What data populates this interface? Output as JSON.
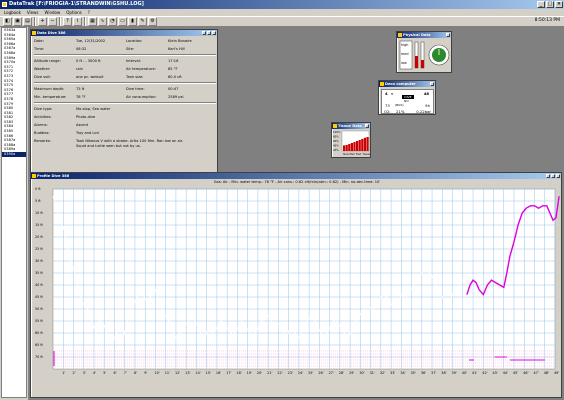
{
  "app": {
    "title": "DataTrak [F:\\FRIOGIA-1\\STRANDWIN\\GSHU.LOG]",
    "clock": "8:50:13 PM"
  },
  "menus": [
    "Logbook",
    "Views",
    "Window",
    "Options",
    "?"
  ],
  "toolbar": [
    "open-icon",
    "save-icon",
    "print-icon",
    "zoom-in-icon",
    "zoom-out-icon",
    "help-icon",
    "info-icon",
    "chart-icon",
    "profile-icon",
    "gauge-icon",
    "deco-icon",
    "tissue-icon",
    "tools-icon",
    "settings-icon"
  ],
  "dive_list": [
    "0363a",
    "0364a",
    "0365a",
    "0366a",
    "0367a",
    "0368a",
    "0369a",
    "0370a",
    "0371",
    "0372",
    "0373",
    "0374",
    "0375",
    "0376",
    "0377",
    "0378",
    "0379",
    "0380",
    "0381",
    "0382",
    "0383",
    "0384",
    "0385",
    "0386",
    "0387a",
    "0388a",
    "0389a",
    "0390a"
  ],
  "selected_dive_index": 27,
  "info": {
    "title": "Data Dive 386",
    "rows": [
      {
        "l1": "Date:",
        "v1": "Tue, 12/31/2002",
        "l2": "Location:",
        "v2": "Klein Bonaire"
      },
      {
        "l1": "Time:",
        "v1": "08:32",
        "l2": "Site:",
        "v2": "Karl's Hill"
      },
      {
        "l1": "Altitude range:",
        "v1": "0 ft ... 3000 ft",
        "l2": "Interval:",
        "v2": "17:16"
      },
      {
        "l1": "Weather:",
        "v1": "rain",
        "l2": "Air temperature:",
        "v2": "85 °F"
      },
      {
        "l1": "Dive suit:",
        "v1": "one pc. wetsuit",
        "l2": "Tank size:",
        "v2": "80.0 cft"
      },
      {
        "l1": "Maximum depth:",
        "v1": "73 ft",
        "l2": "Dive time:",
        "v2": "00:47"
      },
      {
        "l1": "Min. temperature:",
        "v1": "78 °F",
        "l2": "Air consumption:",
        "v2": "2589 psi"
      },
      {
        "l1": "Dive type:",
        "v1": "Mo-slop, Sea water",
        "l2": "",
        "v2": ""
      },
      {
        "l1": "Activities:",
        "v1": "Photo-dive",
        "l2": "",
        "v2": ""
      },
      {
        "l1": "Alarms:",
        "v1": "Ascent",
        "l2": "",
        "v2": ""
      },
      {
        "l1": "Buddies:",
        "v1": "Troy and Lori",
        "l2": "",
        "v2": ""
      },
      {
        "l1": "Remarks:",
        "v1": "Took Nikonos V with a strobe. Artia 100 film. Ran low on air.",
        "l2": "",
        "v2": ""
      }
    ],
    "remarks_line2": "Squid and turtle seen but not by us."
  },
  "physical": {
    "title": "Physical Data",
    "labels": [
      "high",
      "med",
      "low"
    ]
  },
  "deco": {
    "title": "Deco computer",
    "depth": "4",
    "depth_unit": "ft",
    "time": "48",
    "mode_label": "DIVE",
    "mode_value": "NO",
    "pressure": "73",
    "pressure_label": "(BGS)",
    "minutes": "9h",
    "o2_label": "O2:",
    "o2": "21%",
    "ppo2": "0.22bar"
  },
  "tissue": {
    "title": "Tissue Data",
    "y_labels": [
      "100%",
      "80%",
      "60%",
      "40%",
      "20%"
    ],
    "x_labels": [
      "Slow",
      "Med",
      "Fast",
      "Tissue"
    ],
    "values": [
      0.28,
      0.3,
      0.35,
      0.4,
      0.45,
      0.5,
      0.55,
      0.6,
      0.66,
      0.7
    ]
  },
  "profile": {
    "title": "Profile Dive 386",
    "subtitle": "Gas: Air  -  Min. water temp.: 78 °F  -  Air cons.: 0.62 cft/min(atm.: 0.62)  -  Min. no-dec.time: 10'"
  },
  "chart_data": {
    "type": "line",
    "ylabel": "",
    "y_axis_unit": "ft",
    "y_ticks": [
      "0 ft",
      "5 ft",
      "10 ft",
      "15 ft",
      "20 ft",
      "25 ft",
      "30 ft",
      "35 ft",
      "40 ft",
      "45 ft",
      "50 ft",
      "55 ft",
      "60 ft",
      "65 ft",
      "70 ft"
    ],
    "ylim": [
      0,
      75
    ],
    "y_inverted": true,
    "x_ticks": [
      "1'",
      "2'",
      "3'",
      "4'",
      "5'",
      "6'",
      "7'",
      "8'",
      "9'",
      "10'",
      "11'",
      "12'",
      "13'",
      "14'",
      "15'",
      "16'",
      "17'",
      "18'",
      "19'",
      "20'",
      "21'",
      "22'",
      "23'",
      "24'",
      "25'",
      "26'",
      "27'",
      "28'",
      "29'",
      "30'",
      "31'",
      "32'",
      "33'",
      "34'",
      "35'",
      "36'",
      "37'",
      "38'",
      "39'",
      "40'",
      "41'",
      "42'",
      "43'",
      "44'",
      "45'",
      "46'",
      "47'",
      "48'",
      "49'"
    ],
    "xlim": [
      0,
      49
    ],
    "series": [
      {
        "color": "#ffffff",
        "points": [
          [
            0,
            3
          ],
          [
            0.3,
            8
          ],
          [
            0.7,
            13
          ],
          [
            1,
            16
          ],
          [
            1.3,
            22
          ],
          [
            1.6,
            28
          ],
          [
            2,
            33
          ],
          [
            2.3,
            38
          ],
          [
            2.6,
            43
          ],
          [
            3,
            48
          ],
          [
            3.4,
            50
          ],
          [
            3.8,
            55
          ],
          [
            4.2,
            60
          ],
          [
            4.6,
            55
          ],
          [
            5,
            57
          ],
          [
            5.4,
            62
          ],
          [
            5.8,
            64
          ],
          [
            6.2,
            60
          ],
          [
            6.5,
            63
          ],
          [
            6.9,
            62
          ],
          [
            7.3,
            54
          ],
          [
            7.6,
            50
          ],
          [
            8,
            47
          ],
          [
            8.4,
            42
          ],
          [
            8.8,
            44
          ],
          [
            9.2,
            48
          ],
          [
            9.6,
            44
          ],
          [
            10,
            42
          ],
          [
            10.4,
            47
          ],
          [
            10.8,
            52
          ],
          [
            11.2,
            54
          ],
          [
            11.6,
            58
          ],
          [
            12,
            62
          ],
          [
            12.4,
            60
          ],
          [
            12.8,
            57
          ],
          [
            13.2,
            55
          ],
          [
            13.6,
            53
          ],
          [
            14,
            56
          ],
          [
            14.4,
            60
          ],
          [
            14.8,
            57
          ],
          [
            15.2,
            63
          ],
          [
            15.6,
            60
          ],
          [
            16,
            58
          ],
          [
            16.4,
            55
          ],
          [
            16.8,
            57
          ],
          [
            17.2,
            59
          ],
          [
            17.6,
            61
          ],
          [
            18,
            58
          ],
          [
            18.4,
            55
          ],
          [
            18.8,
            57
          ],
          [
            19.2,
            60
          ],
          [
            19.6,
            62
          ],
          [
            20,
            58
          ],
          [
            20.4,
            55
          ],
          [
            20.8,
            52
          ],
          [
            21.2,
            54
          ],
          [
            21.6,
            57
          ],
          [
            22,
            56
          ],
          [
            22.4,
            59
          ],
          [
            22.8,
            62
          ],
          [
            23.2,
            57
          ],
          [
            23.6,
            60
          ],
          [
            24,
            62
          ],
          [
            24.4,
            58
          ],
          [
            24.8,
            55
          ],
          [
            25.2,
            53
          ],
          [
            25.6,
            55
          ],
          [
            26,
            59
          ],
          [
            26.4,
            62
          ],
          [
            26.8,
            60
          ],
          [
            27.2,
            56
          ],
          [
            27.6,
            54
          ],
          [
            28,
            57
          ],
          [
            28.4,
            60
          ],
          [
            28.8,
            62
          ],
          [
            29.2,
            58
          ],
          [
            29.6,
            55
          ],
          [
            30,
            52
          ],
          [
            30.4,
            50
          ],
          [
            30.8,
            48
          ],
          [
            31.2,
            51
          ],
          [
            31.6,
            48
          ],
          [
            32,
            45
          ],
          [
            32.4,
            44
          ],
          [
            32.8,
            47
          ],
          [
            33.2,
            49
          ],
          [
            33.6,
            48
          ],
          [
            34,
            44
          ],
          [
            34.4,
            46
          ],
          [
            34.8,
            43
          ],
          [
            35.2,
            40
          ],
          [
            35.6,
            38
          ],
          [
            36,
            35
          ],
          [
            36.4,
            33
          ],
          [
            36.8,
            35
          ],
          [
            37.2,
            38
          ],
          [
            37.6,
            42
          ],
          [
            38,
            45
          ],
          [
            38.4,
            48
          ],
          [
            38.8,
            46
          ],
          [
            39.2,
            42
          ],
          [
            39.6,
            40
          ],
          [
            40,
            38
          ],
          [
            40.4,
            40
          ]
        ]
      },
      {
        "color": "#dd00dd",
        "points": [
          [
            40.4,
            44
          ],
          [
            40.7,
            40
          ],
          [
            41,
            38
          ],
          [
            41.3,
            39
          ],
          [
            41.6,
            42
          ],
          [
            42,
            44
          ],
          [
            42.4,
            40
          ],
          [
            42.8,
            38
          ],
          [
            43.2,
            39
          ],
          [
            43.6,
            40
          ],
          [
            44,
            41
          ],
          [
            44.3,
            35
          ],
          [
            44.6,
            28
          ],
          [
            45,
            22
          ],
          [
            45.4,
            15
          ],
          [
            45.8,
            10
          ],
          [
            46.2,
            8
          ],
          [
            46.6,
            7
          ],
          [
            47,
            7
          ],
          [
            47.4,
            8
          ],
          [
            47.8,
            7
          ],
          [
            48.2,
            7
          ],
          [
            48.5,
            10
          ],
          [
            48.8,
            13
          ],
          [
            49.1,
            12
          ],
          [
            49.4,
            3
          ]
        ]
      }
    ]
  }
}
